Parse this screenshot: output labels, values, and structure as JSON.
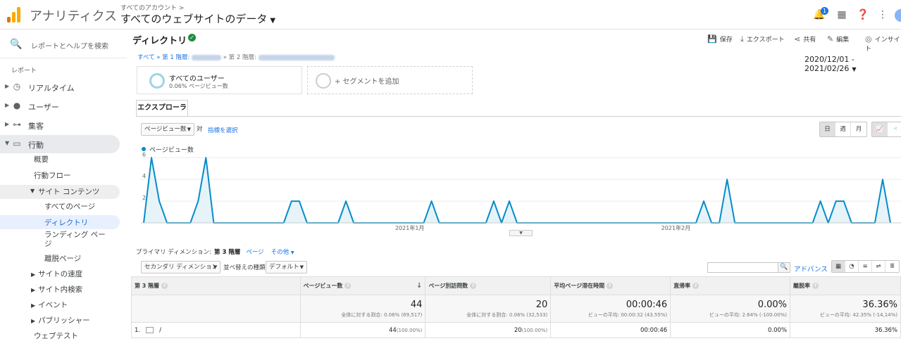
{
  "app": {
    "name": "アナリティクス",
    "account_crumb": "すべてのアカウント >",
    "property": "すべてのウェブサイトのデータ",
    "notification_count": "1",
    "colors": {
      "accent": "#1a73e8",
      "chart_line": "#058dc7",
      "logo_orange": "#f9ab00",
      "logo_dark": "#e37400",
      "verified": "#1e8e3e"
    }
  },
  "sidebar": {
    "search_placeholder": "レポートとヘルプを検索",
    "section_label": "レポート",
    "items": [
      {
        "label": "リアルタイム",
        "icon": "clock-icon"
      },
      {
        "label": "ユーザー",
        "icon": "person-icon"
      },
      {
        "label": "集客",
        "icon": "acquisition-icon"
      },
      {
        "label": "行動",
        "icon": "behavior-icon"
      }
    ],
    "behavior_children": [
      "概要",
      "行動フロー"
    ],
    "site_content": {
      "label": "サイト コンテンツ",
      "children": [
        "すべてのページ",
        "ディレクトリ",
        "ランディング ページ",
        "離脱ページ"
      ]
    },
    "behavior_more": [
      "サイトの速度",
      "サイト内検索",
      "イベント",
      "パブリッシャー"
    ],
    "web_test": "ウェブテスト"
  },
  "report": {
    "title": "ディレクトリ",
    "toolbar": [
      "保存",
      "エクスポート",
      "共有",
      "編集",
      "インサイト"
    ],
    "breadcrumb_root": "すべて",
    "breadcrumb_level1": "» 第 1 階層:",
    "breadcrumb_level2": "» 第 2 階層:",
    "date_range": "2020/12/01 - 2021/02/26",
    "segment_name": "すべてのユーザー",
    "segment_sub": "0.06% ページビュー数",
    "add_segment": "+ セグメントを追加",
    "tab": "エクスプローラ",
    "metric_select": "ページビュー数",
    "vs": "対",
    "select_metric_link": "指標を選択",
    "period_buttons": [
      "日",
      "週",
      "月"
    ]
  },
  "chart_data": {
    "type": "area",
    "series": [
      {
        "name": "ページビュー数",
        "values": [
          0,
          6,
          2,
          0,
          0,
          0,
          0,
          2,
          6,
          0,
          0,
          0,
          0,
          0,
          0,
          0,
          0,
          0,
          0,
          2,
          2,
          0,
          0,
          0,
          0,
          0,
          2,
          0,
          0,
          0,
          0,
          0,
          0,
          0,
          0,
          0,
          0,
          2,
          0,
          0,
          0,
          0,
          0,
          0,
          0,
          2,
          0,
          2,
          0,
          0,
          0,
          0,
          0,
          0,
          0,
          0,
          0,
          0,
          0,
          0,
          0,
          0,
          0,
          0,
          0,
          0,
          0,
          0,
          0,
          0,
          0,
          0,
          2,
          0,
          0,
          4,
          0,
          0,
          0,
          0,
          0,
          0,
          0,
          0,
          0,
          0,
          0,
          2,
          0,
          2,
          2,
          0,
          0,
          0,
          0,
          4,
          0
        ]
      }
    ],
    "x_labels": [
      "2021年1月",
      "2021年2月"
    ],
    "yticks": [
      2,
      4,
      6
    ],
    "ylim": [
      0,
      6.6
    ],
    "x_range": [
      "2020/12/01",
      "2021/02/26"
    ]
  },
  "table_controls": {
    "primary_dim_label": "プライマリ ディメンション:",
    "primary_dim_current": "第 3 階層",
    "primary_dim_alt": "ページ",
    "primary_dim_other": "その他",
    "secondary_dim": "セカンダリ ディメンション",
    "sort_type_label": "並べ替えの種類:",
    "sort_type": "デフォルト",
    "advanced": "アドバンス"
  },
  "table": {
    "headers": [
      "第 3 階層",
      "ページビュー数",
      "ページ別訪問数",
      "平均ページ滞在時間",
      "直帰率",
      "離脱率"
    ],
    "totals": [
      {
        "value": "44",
        "sub": "全体に対する割合: 0.06% (69,517)"
      },
      {
        "value": "20",
        "sub": "全体に対する割合: 0.06% (32,533)"
      },
      {
        "value": "00:00:46",
        "sub": "ビューの平均: 00:00:32 (43.55%)"
      },
      {
        "value": "0.00%",
        "sub": "ビューの平均: 2.64% (-100.00%)"
      },
      {
        "value": "36.36%",
        "sub": "ビューの平均: 42.35% (-14,14%)"
      }
    ],
    "rows": [
      {
        "index": "1.",
        "dim": "/",
        "pv": "44",
        "pv_pct": "(100.00%)",
        "visits": "20",
        "visits_pct": "(100.00%)",
        "avg_time": "00:00:46",
        "bounce": "0.00%",
        "exit": "36.36%"
      }
    ]
  }
}
